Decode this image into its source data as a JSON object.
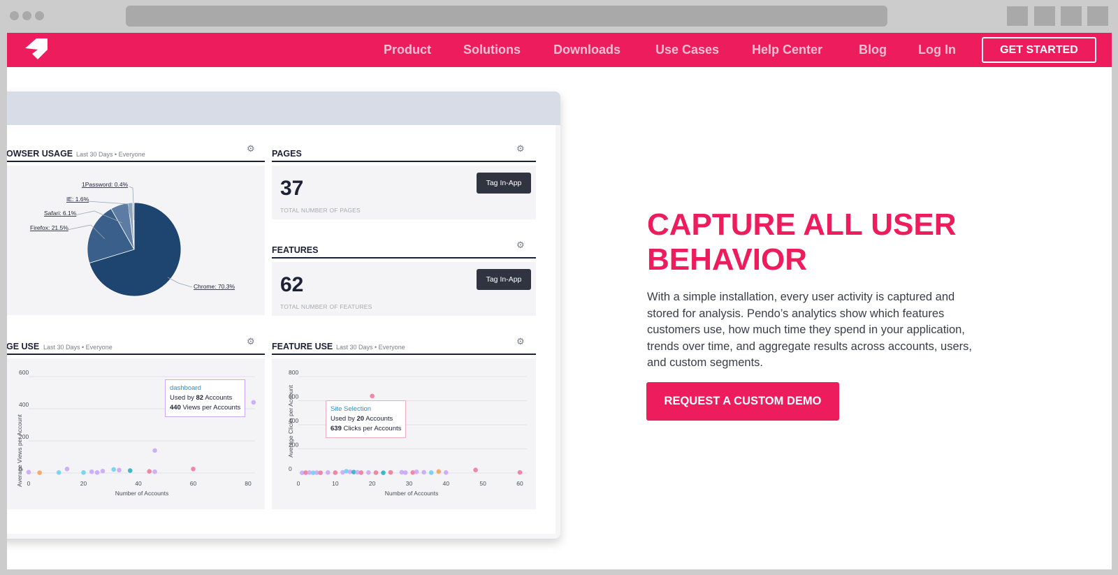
{
  "nav": {
    "items": [
      "Product",
      "Solutions",
      "Downloads",
      "Use Cases",
      "Help Center",
      "Blog",
      "Log In"
    ],
    "cta": "GET STARTED"
  },
  "colors": {
    "brand": "#ec1c5d",
    "panel_dark": "#1d2136",
    "pie_fill": "#1e4470",
    "pie_slice": "#3a5f8a"
  },
  "dashboard": {
    "browser": {
      "title": "OWSER USAGE",
      "meta": "Last 30 Days  •  Everyone",
      "pie_labels": [
        "1Password: 0.4%",
        "IE: 1.6%",
        "Safari: 6.1%",
        "Firefox: 21.5%",
        "Chrome: 70.3%"
      ]
    },
    "pages": {
      "title": "PAGES",
      "value": "37",
      "caption": "TOTAL NUMBER OF PAGES",
      "button": "Tag In-App"
    },
    "features": {
      "title": "FEATURES",
      "value": "62",
      "caption": "TOTAL NUMBER OF FEATURES",
      "button": "Tag In-App"
    },
    "page_use": {
      "title": "GE USE",
      "meta": "Last 30 Days  •  Everyone",
      "ylabel": "Average Views per Account",
      "xlabel": "Number of Accounts",
      "yticks": [
        "600",
        "400",
        "200",
        "0"
      ],
      "xticks": [
        "0",
        "20",
        "40",
        "60",
        "80"
      ],
      "tooltip": {
        "title": "dashboard",
        "line1_pre": "Used by ",
        "line1_num": "82",
        "line1_post": " Accounts",
        "line2_num": "440",
        "line2_post": " Views per Accounts"
      }
    },
    "feature_use": {
      "title": "FEATURE USE",
      "meta": "Last 30 Days  •  Everyone",
      "ylabel": "Average Clicks per Account",
      "xlabel": "Number of Accounts",
      "yticks": [
        "800",
        "600",
        "400",
        "200",
        "0"
      ],
      "xticks": [
        "0",
        "10",
        "20",
        "30",
        "40",
        "50",
        "60"
      ],
      "tooltip": {
        "title": "Site Selection",
        "line1_pre": "Used by ",
        "line1_num": "20",
        "line1_post": " Accounts",
        "line2_num": "639",
        "line2_post": " Clicks per Accounts"
      }
    }
  },
  "chart_data": [
    {
      "type": "pie",
      "title": "OWSER USAGE",
      "categories": [
        "1Password",
        "IE",
        "Safari",
        "Firefox",
        "Chrome"
      ],
      "values": [
        0.4,
        1.6,
        6.1,
        21.5,
        70.3
      ]
    },
    {
      "type": "scatter",
      "title": "GE USE",
      "xlabel": "Number of Accounts",
      "ylabel": "Average Views per Account",
      "xlim": [
        0,
        80
      ],
      "ylim": [
        0,
        600
      ],
      "points": [
        {
          "x": 0,
          "y": 5,
          "c": "#c9a8f7"
        },
        {
          "x": 4,
          "y": 2,
          "c": "#f7a25b"
        },
        {
          "x": 11,
          "y": 3,
          "c": "#6fd1f2"
        },
        {
          "x": 14,
          "y": 25,
          "c": "#c9a8f7"
        },
        {
          "x": 20,
          "y": 3,
          "c": "#6fd1f2"
        },
        {
          "x": 23,
          "y": 8,
          "c": "#c9a8f7"
        },
        {
          "x": 25,
          "y": 3,
          "c": "#c9a8f7"
        },
        {
          "x": 27,
          "y": 12,
          "c": "#c9a8f7"
        },
        {
          "x": 31,
          "y": 22,
          "c": "#6fd1f2"
        },
        {
          "x": 33,
          "y": 18,
          "c": "#c9a8f7"
        },
        {
          "x": 37,
          "y": 15,
          "c": "#2ab2c2"
        },
        {
          "x": 44,
          "y": 10,
          "c": "#f07b9c"
        },
        {
          "x": 46,
          "y": 8,
          "c": "#c9a8f7"
        },
        {
          "x": 46,
          "y": 140,
          "c": "#c9a8f7"
        },
        {
          "x": 60,
          "y": 25,
          "c": "#f07b9c"
        },
        {
          "x": 82,
          "y": 440,
          "c": "#c9a8f7"
        }
      ]
    },
    {
      "type": "scatter",
      "title": "FEATURE USE",
      "xlabel": "Number of Accounts",
      "ylabel": "Average Clicks per Account",
      "xlim": [
        0,
        60
      ],
      "ylim": [
        0,
        800
      ],
      "points": [
        {
          "x": 1,
          "y": 2,
          "c": "#c9a8f7"
        },
        {
          "x": 2,
          "y": 3,
          "c": "#f07b9c"
        },
        {
          "x": 3,
          "y": 4,
          "c": "#c9a8f7"
        },
        {
          "x": 4,
          "y": 2,
          "c": "#6fd1f2"
        },
        {
          "x": 5,
          "y": 3,
          "c": "#c9a8f7"
        },
        {
          "x": 6,
          "y": 2,
          "c": "#f07b9c"
        },
        {
          "x": 8,
          "y": 4,
          "c": "#c9a8f7"
        },
        {
          "x": 10,
          "y": 3,
          "c": "#f07b9c"
        },
        {
          "x": 12,
          "y": 5,
          "c": "#c9a8f7"
        },
        {
          "x": 13,
          "y": 15,
          "c": "#6fd1f2"
        },
        {
          "x": 14,
          "y": 10,
          "c": "#c9a8f7"
        },
        {
          "x": 15,
          "y": 8,
          "c": "#2ab2c2"
        },
        {
          "x": 16,
          "y": 6,
          "c": "#c9a8f7"
        },
        {
          "x": 17,
          "y": 3,
          "c": "#f07b9c"
        },
        {
          "x": 19,
          "y": 4,
          "c": "#c9a8f7"
        },
        {
          "x": 20,
          "y": 639,
          "c": "#f07b9c"
        },
        {
          "x": 21,
          "y": 3,
          "c": "#f07b9c"
        },
        {
          "x": 23,
          "y": 2,
          "c": "#2ab2c2"
        },
        {
          "x": 25,
          "y": 5,
          "c": "#f07b9c"
        },
        {
          "x": 28,
          "y": 6,
          "c": "#c9a8f7"
        },
        {
          "x": 29,
          "y": 3,
          "c": "#c9a8f7"
        },
        {
          "x": 31,
          "y": 4,
          "c": "#f07b9c"
        },
        {
          "x": 32,
          "y": 10,
          "c": "#c9a8f7"
        },
        {
          "x": 34,
          "y": 6,
          "c": "#c9a8f7"
        },
        {
          "x": 36,
          "y": 3,
          "c": "#6fd1f2"
        },
        {
          "x": 38,
          "y": 12,
          "c": "#f7a25b"
        },
        {
          "x": 40,
          "y": 4,
          "c": "#c9a8f7"
        },
        {
          "x": 48,
          "y": 25,
          "c": "#f07b9c"
        },
        {
          "x": 60,
          "y": 5,
          "c": "#f07b9c"
        }
      ]
    }
  ],
  "hero": {
    "title_lines": [
      "CAPTURE ALL USER",
      "BEHAVIOR"
    ],
    "text": "With a simple installation, every user activity is captured and stored for analysis. Pendo’s analytics show which features customers use, how much time they spend in your application, trends over time, and aggregate results across accounts, users, and custom segments.",
    "button": "REQUEST A CUSTOM DEMO"
  }
}
